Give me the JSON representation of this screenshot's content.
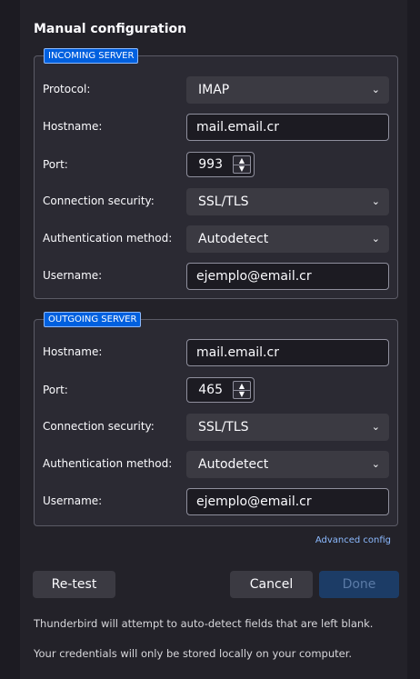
{
  "title": "Manual configuration",
  "incoming": {
    "legend": "INCOMING SERVER",
    "protocol_label": "Protocol:",
    "protocol_value": "IMAP",
    "hostname_label": "Hostname:",
    "hostname_value": "mail.email.cr",
    "port_label": "Port:",
    "port_value": "993",
    "security_label": "Connection security:",
    "security_value": "SSL/TLS",
    "auth_label": "Authentication method:",
    "auth_value": "Autodetect",
    "username_label": "Username:",
    "username_value": "ejemplo@email.cr"
  },
  "outgoing": {
    "legend": "OUTGOING SERVER",
    "hostname_label": "Hostname:",
    "hostname_value": "mail.email.cr",
    "port_label": "Port:",
    "port_value": "465",
    "security_label": "Connection security:",
    "security_value": "SSL/TLS",
    "auth_label": "Authentication method:",
    "auth_value": "Autodetect",
    "username_label": "Username:",
    "username_value": "ejemplo@email.cr"
  },
  "advanced_link": "Advanced config",
  "buttons": {
    "retest": "Re-test",
    "cancel": "Cancel",
    "done": "Done"
  },
  "notes": {
    "autodetect": "Thunderbird will attempt to auto-detect fields that are left blank.",
    "credentials": "Your credentials will only be stored locally on your computer."
  },
  "icons": {
    "dropdown": "chevron-down-icon",
    "spin_up": "chevron-up-icon",
    "spin_down": "chevron-down-icon"
  },
  "colors": {
    "accent": "#0060df",
    "link": "#8cbaff",
    "background": "#1c1b22"
  }
}
